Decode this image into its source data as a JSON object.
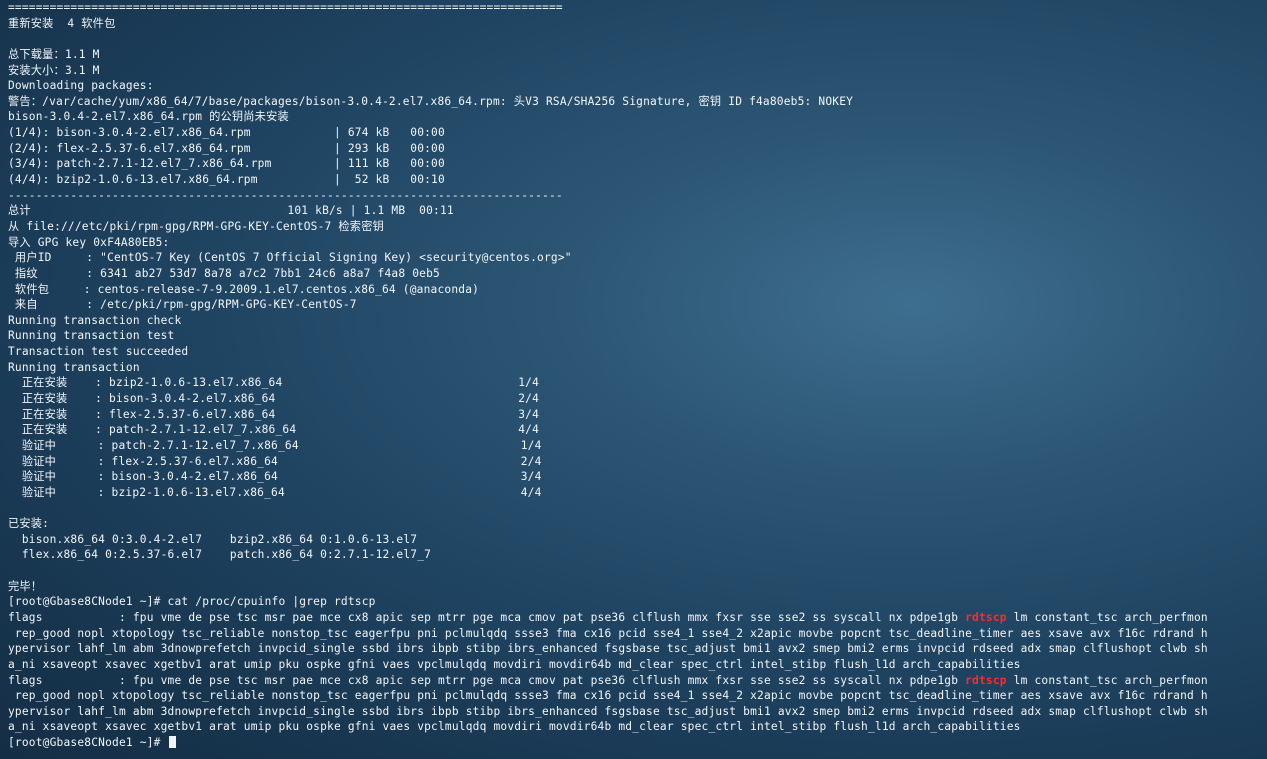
{
  "terminal": {
    "lines": [
      "================================================================================",
      "重新安装  4 软件包",
      "",
      "总下载量：1.1 M",
      "安装大小：3.1 M",
      "Downloading packages:",
      "警告：/var/cache/yum/x86_64/7/base/packages/bison-3.0.4-2.el7.x86_64.rpm: 头V3 RSA/SHA256 Signature, 密钥 ID f4a80eb5: NOKEY",
      "bison-3.0.4-2.el7.x86_64.rpm 的公钥尚未安装",
      "(1/4): bison-3.0.4-2.el7.x86_64.rpm            | 674 kB   00:00",
      "(2/4): flex-2.5.37-6.el7.x86_64.rpm            | 293 kB   00:00",
      "(3/4): patch-2.7.1-12.el7_7.x86_64.rpm         | 111 kB   00:00",
      "(4/4): bzip2-1.0.6-13.el7.x86_64.rpm           |  52 kB   00:10",
      "--------------------------------------------------------------------------------",
      "总计                                     101 kB/s | 1.1 MB  00:11",
      "从 file:///etc/pki/rpm-gpg/RPM-GPG-KEY-CentOS-7 检索密钥",
      "导入 GPG key 0xF4A80EB5:",
      " 用户ID     : \"CentOS-7 Key (CentOS 7 Official Signing Key) <security@centos.org>\"",
      " 指纹       : 6341 ab27 53d7 8a78 a7c2 7bb1 24c6 a8a7 f4a8 0eb5",
      " 软件包     : centos-release-7-9.2009.1.el7.centos.x86_64 (@anaconda)",
      " 来自       : /etc/pki/rpm-gpg/RPM-GPG-KEY-CentOS-7",
      "Running transaction check",
      "Running transaction test",
      "Transaction test succeeded",
      "Running transaction",
      "  正在安装    : bzip2-1.0.6-13.el7.x86_64                                  1/4",
      "  正在安装    : bison-3.0.4-2.el7.x86_64                                   2/4",
      "  正在安装    : flex-2.5.37-6.el7.x86_64                                   3/4",
      "  正在安装    : patch-2.7.1-12.el7_7.x86_64                                4/4",
      "  验证中      : patch-2.7.1-12.el7_7.x86_64                                1/4",
      "  验证中      : flex-2.5.37-6.el7.x86_64                                   2/4",
      "  验证中      : bison-3.0.4-2.el7.x86_64                                   3/4",
      "  验证中      : bzip2-1.0.6-13.el7.x86_64                                  4/4",
      "",
      "已安装:",
      "  bison.x86_64 0:3.0.4-2.el7    bzip2.x86_64 0:1.0.6-13.el7",
      "  flex.x86_64 0:2.5.37-6.el7    patch.x86_64 0:2.7.1-12.el7_7",
      "",
      "完毕！",
      "[root@Gbase8CNode1 ~]# cat /proc/cpuinfo |grep rdtscp",
      [
        "flags           : fpu vme de pse tsc msr pae mce cx8 apic sep mtrr pge mca cmov pat pse36 clflush mmx fxsr sse sse2 ss syscall nx pdpe1gb ",
        "rdtscp",
        " lm constant_tsc arch_perfmon"
      ],
      " rep_good nopl xtopology tsc_reliable nonstop_tsc eagerfpu pni pclmulqdq ssse3 fma cx16 pcid sse4_1 sse4_2 x2apic movbe popcnt tsc_deadline_timer aes xsave avx f16c rdrand h",
      "ypervisor lahf_lm abm 3dnowprefetch invpcid_single ssbd ibrs ibpb stibp ibrs_enhanced fsgsbase tsc_adjust bmi1 avx2 smep bmi2 erms invpcid rdseed adx smap clflushopt clwb sh",
      "a_ni xsaveopt xsavec xgetbv1 arat umip pku ospke gfni vaes vpclmulqdq movdiri movdir64b md_clear spec_ctrl intel_stibp flush_l1d arch_capabilities",
      [
        "flags           : fpu vme de pse tsc msr pae mce cx8 apic sep mtrr pge mca cmov pat pse36 clflush mmx fxsr sse sse2 ss syscall nx pdpe1gb ",
        "rdtscp",
        " lm constant_tsc arch_perfmon"
      ],
      " rep_good nopl xtopology tsc_reliable nonstop_tsc eagerfpu pni pclmulqdq ssse3 fma cx16 pcid sse4_1 sse4_2 x2apic movbe popcnt tsc_deadline_timer aes xsave avx f16c rdrand h",
      "ypervisor lahf_lm abm 3dnowprefetch invpcid_single ssbd ibrs ibpb stibp ibrs_enhanced fsgsbase tsc_adjust bmi1 avx2 smep bmi2 erms invpcid rdseed adx smap clflushopt clwb sh",
      "a_ni xsaveopt xsavec xgetbv1 arat umip pku ospke gfni vaes vpclmulqdq movdiri movdir64b md_clear spec_ctrl intel_stibp flush_l1d arch_capabilities",
      "[root@Gbase8CNode1 ~]# "
    ],
    "colors": {
      "text": "#f2f5f8",
      "highlight": "#ff2a2a",
      "background": "#1f4462"
    }
  }
}
